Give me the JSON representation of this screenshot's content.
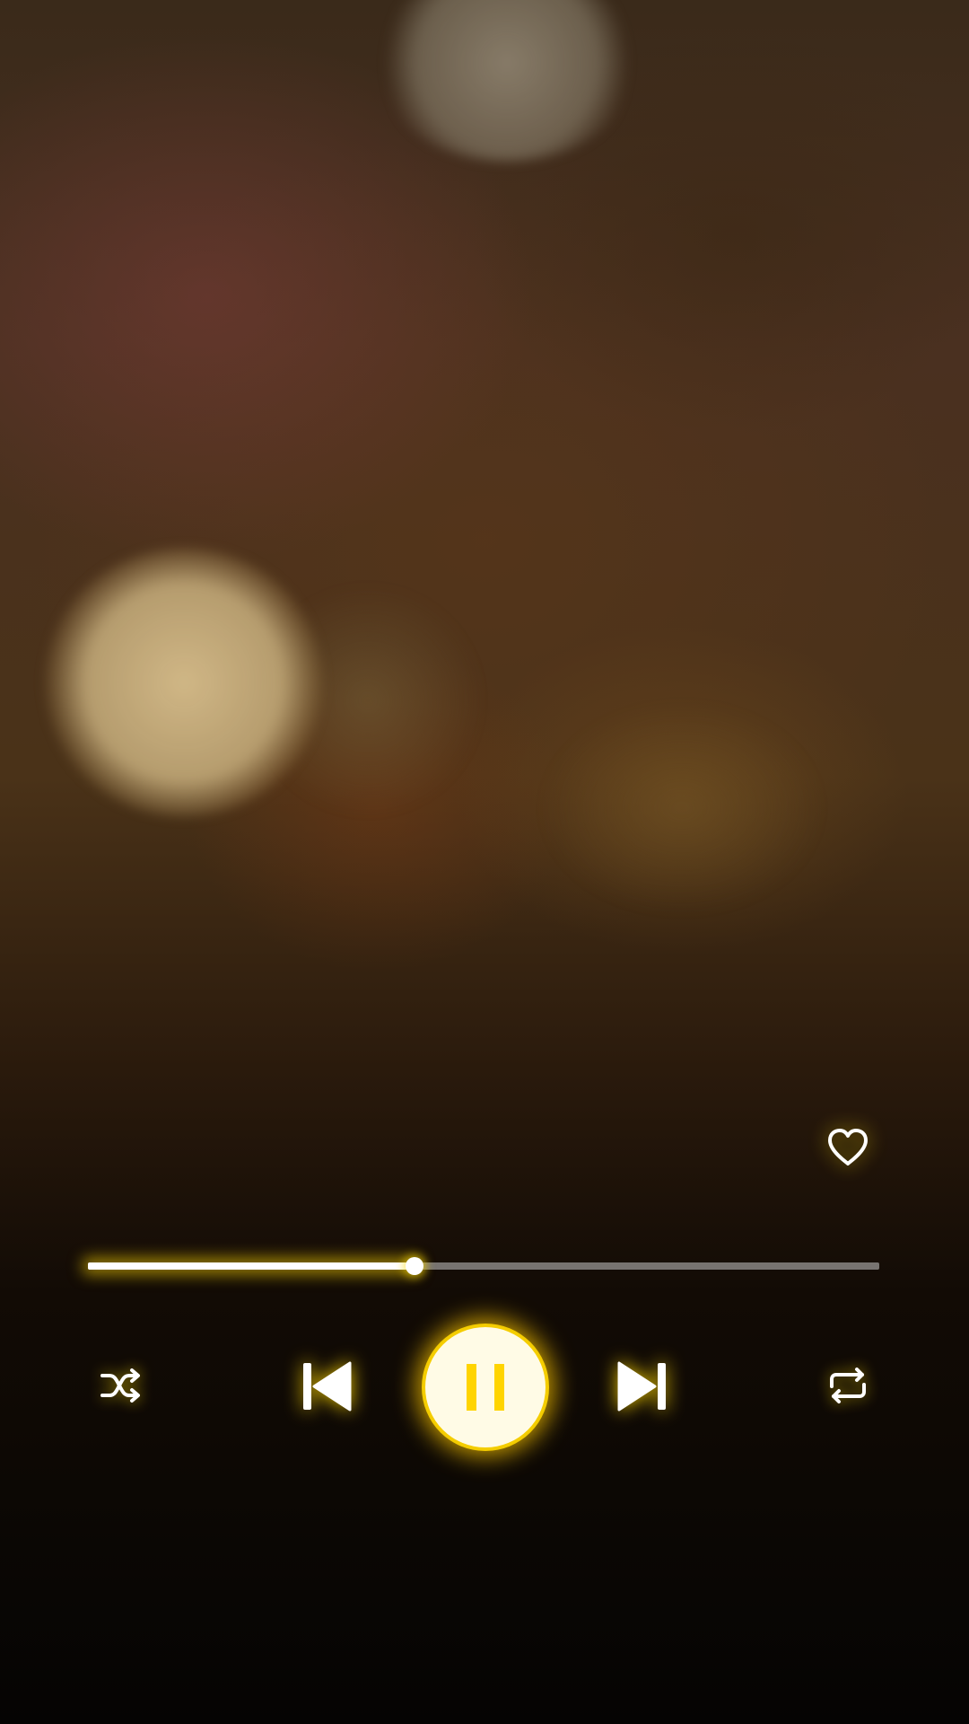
{
  "player": {
    "progress_fraction": 0.413,
    "is_playing": true,
    "is_favorite": false,
    "accent_color": "#FFD400",
    "icons": {
      "favorite": "heart-outline-icon",
      "shuffle": "shuffle-icon",
      "previous": "skip-previous-icon",
      "play_pause": "pause-icon",
      "next": "skip-next-icon",
      "repeat": "repeat-icon"
    }
  }
}
